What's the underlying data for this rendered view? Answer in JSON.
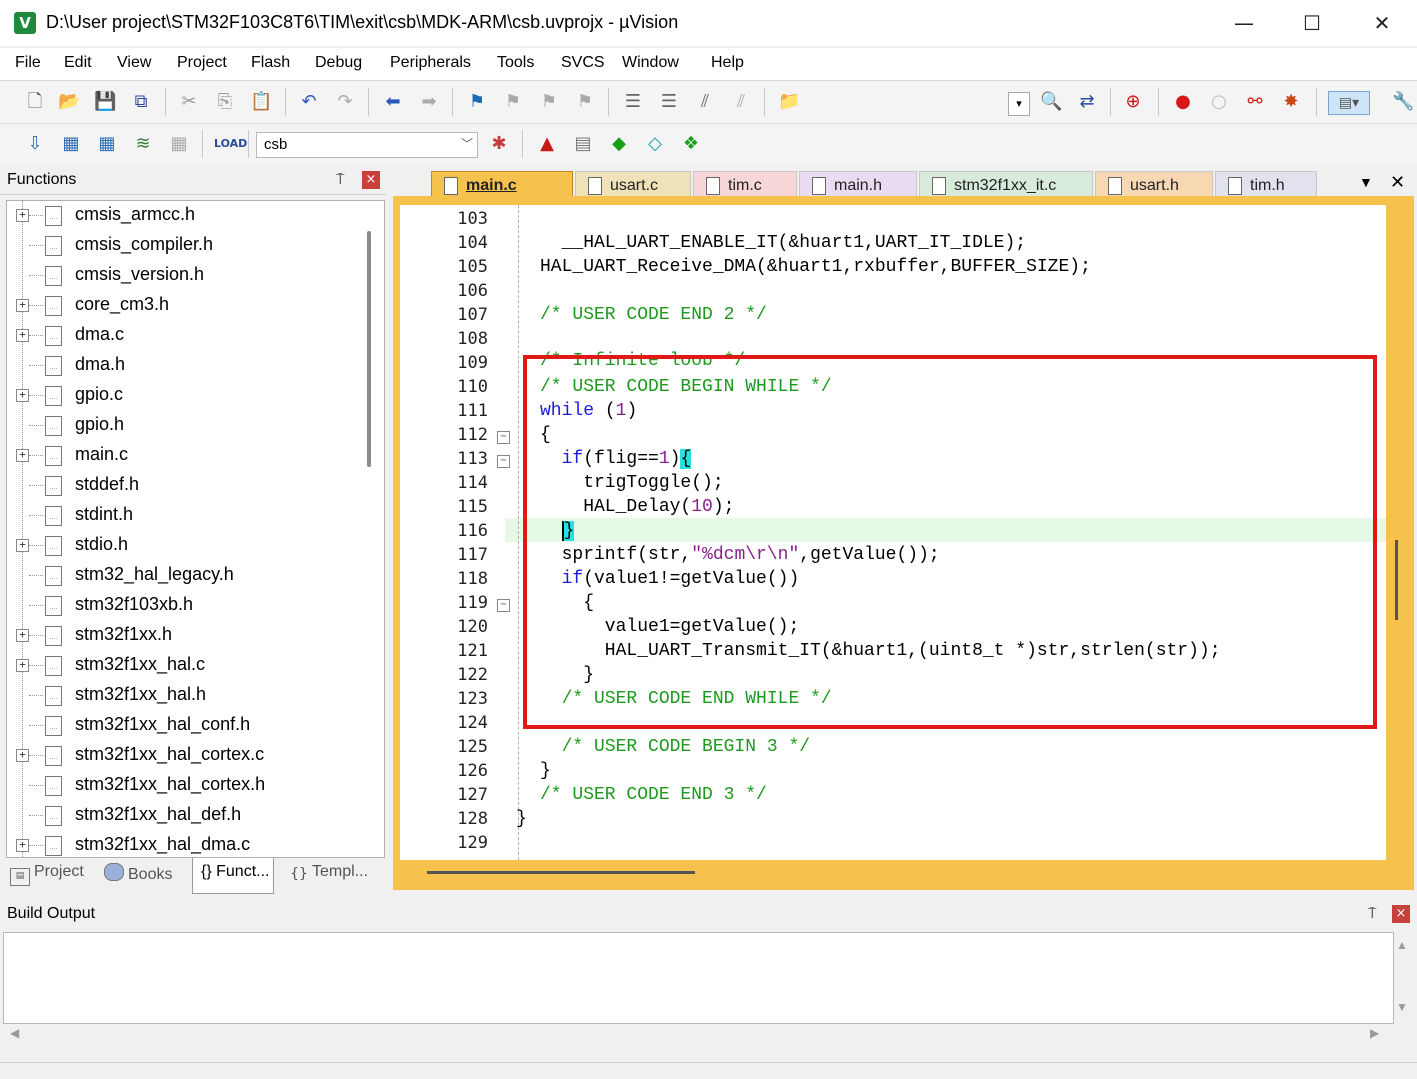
{
  "window": {
    "title": "D:\\User project\\STM32F103C8T6\\TIM\\exit\\csb\\MDK-ARM\\csb.uvprojx - µVision",
    "app_icon": "V",
    "minimize": "—",
    "maximize": "☐",
    "close": "✕"
  },
  "menu": [
    "File",
    "Edit",
    "View",
    "Project",
    "Flash",
    "Debug",
    "Peripherals",
    "Tools",
    "SVCS",
    "Window",
    "Help"
  ],
  "toolbar": {
    "target_name": "csb"
  },
  "functions_panel": {
    "title": "Functions",
    "pin": "⍑",
    "close": "×",
    "items": [
      {
        "label": "cmsis_armcc.h",
        "expandable": true
      },
      {
        "label": "cmsis_compiler.h",
        "expandable": false
      },
      {
        "label": "cmsis_version.h",
        "expandable": false
      },
      {
        "label": "core_cm3.h",
        "expandable": true
      },
      {
        "label": "dma.c",
        "expandable": true
      },
      {
        "label": "dma.h",
        "expandable": false
      },
      {
        "label": "gpio.c",
        "expandable": true
      },
      {
        "label": "gpio.h",
        "expandable": false
      },
      {
        "label": "main.c",
        "expandable": true
      },
      {
        "label": "stddef.h",
        "expandable": false
      },
      {
        "label": "stdint.h",
        "expandable": false
      },
      {
        "label": "stdio.h",
        "expandable": true
      },
      {
        "label": "stm32_hal_legacy.h",
        "expandable": false
      },
      {
        "label": "stm32f103xb.h",
        "expandable": false
      },
      {
        "label": "stm32f1xx.h",
        "expandable": true
      },
      {
        "label": "stm32f1xx_hal.c",
        "expandable": true
      },
      {
        "label": "stm32f1xx_hal.h",
        "expandable": false
      },
      {
        "label": "stm32f1xx_hal_conf.h",
        "expandable": false
      },
      {
        "label": "stm32f1xx_hal_cortex.c",
        "expandable": true
      },
      {
        "label": "stm32f1xx_hal_cortex.h",
        "expandable": false
      },
      {
        "label": "stm32f1xx_hal_def.h",
        "expandable": false
      },
      {
        "label": "stm32f1xx_hal_dma.c",
        "expandable": true
      }
    ],
    "bottom_tabs": [
      {
        "label": "Project",
        "icon": "project-icon"
      },
      {
        "label": "Books",
        "icon": "books-icon"
      },
      {
        "label": "{} Funct...",
        "icon": "functions-icon",
        "active": true
      },
      {
        "label": "Templ...",
        "icon": "templates-icon"
      }
    ]
  },
  "editor": {
    "tabs": [
      {
        "label": "main.c",
        "active": true,
        "color": "#f5c24d"
      },
      {
        "label": "usart.c",
        "color": "#efe2b8"
      },
      {
        "label": "tim.c",
        "color": "#f6d6d6"
      },
      {
        "label": "main.h",
        "color": "#e9dcf2"
      },
      {
        "label": "stm32f1xx_it.c",
        "color": "#d8ead9"
      },
      {
        "label": "usart.h",
        "color": "#f7d8b2"
      },
      {
        "label": "tim.h",
        "color": "#e2e2ee"
      }
    ],
    "line_numbers": [
      "103",
      "104",
      "105",
      "106",
      "107",
      "108",
      "109",
      "110",
      "111",
      "112",
      "113",
      "114",
      "115",
      "116",
      "117",
      "118",
      "119",
      "120",
      "121",
      "122",
      "123",
      "124",
      "125",
      "126",
      "127",
      "128",
      "129"
    ],
    "fold_markers": [
      "112",
      "113",
      "119"
    ],
    "current_line": "116",
    "highlight_color": "#e01818"
  },
  "build_output": {
    "title": "Build Output",
    "pin": "⍑",
    "close": "×"
  }
}
